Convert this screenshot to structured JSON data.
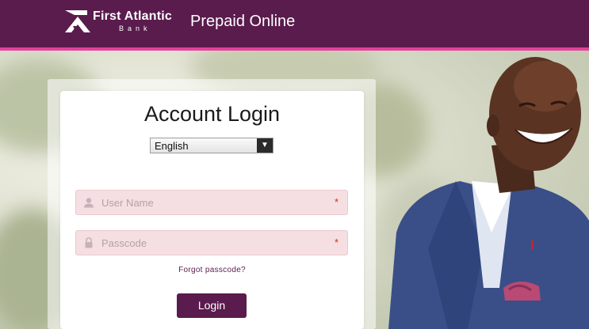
{
  "header": {
    "brand_name": "First Atlantic",
    "brand_sub": "Bank",
    "app_title": "Prepaid Online",
    "logo_icon": "fab-logo-icon",
    "bg_color": "#5a1b4d",
    "accent_color": "#e3429c"
  },
  "login": {
    "title": "Account Login",
    "language": "English",
    "username_placeholder": "User Name",
    "username_required": "*",
    "passcode_placeholder": "Passcode",
    "passcode_required": "*",
    "forgot_label": "Forgot passcode?",
    "button_label": "Login",
    "username_icon": "user-icon",
    "passcode_icon": "lock-icon"
  }
}
